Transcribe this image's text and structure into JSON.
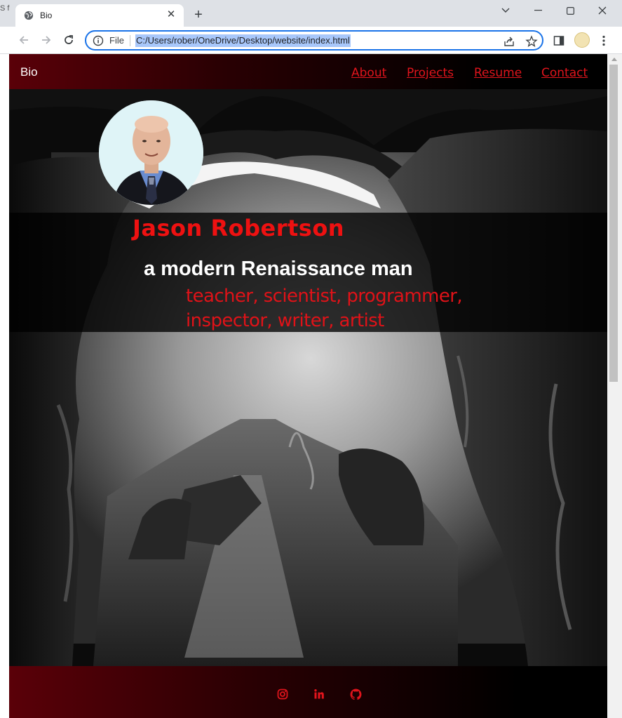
{
  "browser": {
    "left_edge_text": "S f",
    "tab": {
      "title": "Bio"
    },
    "address_bar": {
      "scheme_label": "File",
      "url": "C:/Users/rober/OneDrive/Desktop/website/index.html"
    }
  },
  "site": {
    "nav": {
      "brand": "Bio",
      "links": [
        "About",
        "Projects",
        "Resume",
        "Contact"
      ]
    },
    "hero": {
      "name": "Jason Robertson",
      "tagline": "a modern Renaissance man",
      "roles_line1": "teacher, scientist, programmer,",
      "roles_line2": "inspector, writer, artist"
    },
    "footer": {
      "social_icons": [
        "instagram-icon",
        "linkedin-icon",
        "github-icon"
      ]
    },
    "colors": {
      "accent_red": "#e0141c",
      "nav_gradient_start": "#5a0008",
      "background": "#050505"
    }
  }
}
